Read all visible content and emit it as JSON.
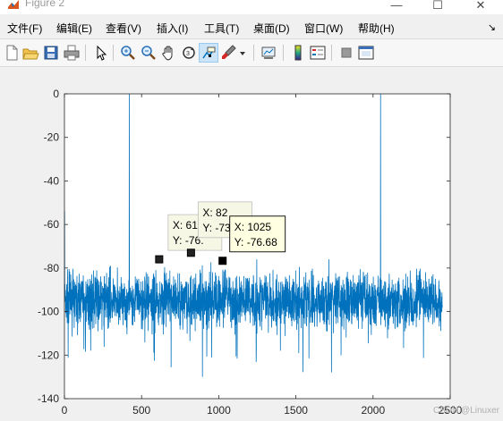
{
  "window": {
    "title": "Figure 2",
    "controls": {
      "minimize": "—",
      "maximize": "☐",
      "close": "✕"
    }
  },
  "menu": {
    "items": [
      "文件(F)",
      "编辑(E)",
      "查看(V)",
      "插入(I)",
      "工具(T)",
      "桌面(D)",
      "窗口(W)",
      "帮助(H)"
    ],
    "overflow": "↘"
  },
  "toolbar": {
    "buttons": [
      "new-figure-icon",
      "open-file-icon",
      "save-icon",
      "print-icon",
      "edit-plot-arrow-icon",
      "zoom-in-icon",
      "zoom-out-icon",
      "pan-hand-icon",
      "rotate-3d-icon",
      "data-cursor-icon",
      "brush-icon",
      "brush-dropdown-icon",
      "link-plot-icon",
      "insert-colorbar-icon",
      "insert-legend-icon",
      "hide-plot-tools-icon",
      "show-plot-tools-icon"
    ],
    "active": "data-cursor-icon"
  },
  "chart_data": {
    "type": "line",
    "color": "#0072bd",
    "xlim": [
      0,
      2500
    ],
    "ylim": [
      -140,
      0
    ],
    "xticks": [
      0,
      500,
      1000,
      1500,
      2000,
      2500
    ],
    "yticks": [
      0,
      -20,
      -40,
      -60,
      -80,
      -100,
      -120,
      -140
    ],
    "xtick_labels": [
      "0",
      "500",
      "1000",
      "1500",
      "2000",
      "2500"
    ],
    "ytick_labels": [
      "0",
      "-20",
      "-40",
      "-60",
      "-80",
      "-100",
      "-120",
      "-140"
    ],
    "grid": false,
    "n_points": 2448,
    "noise_floor": -95,
    "noise_band": [
      -115,
      -80
    ],
    "min_value": -130,
    "spikes": [
      {
        "x": 0,
        "y": -54
      },
      {
        "x": 420,
        "y": 0
      },
      {
        "x": 2049,
        "y": 0
      }
    ],
    "datatips": [
      {
        "x": 614,
        "y": -76,
        "x_text": "X: 614",
        "y_text": "Y: -76.",
        "state": "inactive"
      },
      {
        "x": 820,
        "y": -73,
        "x_text": "X: 82",
        "y_text": "Y: -73",
        "state": "inactive"
      },
      {
        "x": 1025,
        "y": -76.68,
        "x_text": "X: 1025",
        "y_text": "Y: -76.68",
        "state": "active"
      }
    ]
  },
  "watermark": "CSDN @Linuxer"
}
